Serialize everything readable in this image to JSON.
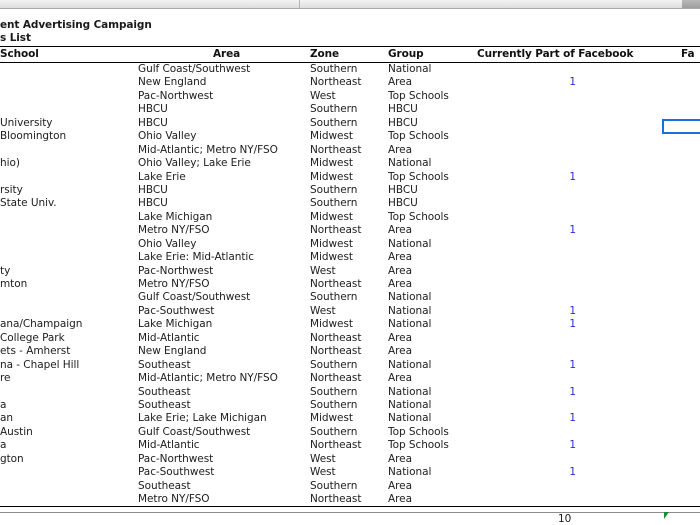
{
  "window": {
    "column_header_divider_x": [
      300,
      693,
      858,
      1065
    ],
    "scroll_corner": "scroll-corner"
  },
  "document": {
    "title": "ent Advertising Campaign",
    "subtitle": "s List"
  },
  "table": {
    "columns": [
      {
        "key": "school",
        "label": "School"
      },
      {
        "key": "area",
        "label": "Area"
      },
      {
        "key": "zone",
        "label": "Zone"
      },
      {
        "key": "group",
        "label": "Group"
      },
      {
        "key": "fb",
        "label": "Currently Part of Facebook"
      },
      {
        "key": "fb2",
        "label": "Fa"
      }
    ],
    "rows": [
      {
        "school": "",
        "area": "Gulf Coast/Southwest",
        "zone": "Southern",
        "group": "National",
        "fb": ""
      },
      {
        "school": "",
        "area": "New England",
        "zone": "Northeast",
        "group": "Area",
        "fb": "1"
      },
      {
        "school": "",
        "area": "Pac-Northwest",
        "zone": "West",
        "group": "Top Schools",
        "fb": ""
      },
      {
        "school": "",
        "area": "HBCU",
        "zone": "Southern",
        "group": "HBCU",
        "fb": ""
      },
      {
        "school": " University",
        "area": "HBCU",
        "zone": "Southern",
        "group": "HBCU",
        "fb": ""
      },
      {
        "school": " Bloomington",
        "area": "Ohio Valley",
        "zone": "Midwest",
        "group": "Top Schools",
        "fb": ""
      },
      {
        "school": "",
        "area": "Mid-Atlantic; Metro NY/FSO",
        "zone": "Northeast",
        "group": "Area",
        "fb": ""
      },
      {
        "school": "hio)",
        "area": "Ohio Valley; Lake Erie",
        "zone": "Midwest",
        "group": "National",
        "fb": ""
      },
      {
        "school": "",
        "area": "Lake Erie",
        "zone": "Midwest",
        "group": "Top Schools",
        "fb": "1"
      },
      {
        "school": "rsity",
        "area": "HBCU",
        "zone": "Southern",
        "group": "HBCU",
        "fb": ""
      },
      {
        "school": "State Univ.",
        "area": "HBCU",
        "zone": "Southern",
        "group": "HBCU",
        "fb": ""
      },
      {
        "school": "",
        "area": "Lake Michigan",
        "zone": "Midwest",
        "group": "Top Schools",
        "fb": ""
      },
      {
        "school": "",
        "area": "Metro NY/FSO",
        "zone": "Northeast",
        "group": "Area",
        "fb": "1"
      },
      {
        "school": "",
        "area": "Ohio Valley",
        "zone": "Midwest",
        "group": "National",
        "fb": ""
      },
      {
        "school": "",
        "area": "Lake Erie: Mid-Atlantic",
        "zone": "Midwest",
        "group": "Area",
        "fb": ""
      },
      {
        "school": "ty",
        "area": "Pac-Northwest",
        "zone": "West",
        "group": "Area",
        "fb": ""
      },
      {
        "school": "mton",
        "area": "Metro NY/FSO",
        "zone": "Northeast",
        "group": "Area",
        "fb": ""
      },
      {
        "school": "",
        "area": "Gulf Coast/Southwest",
        "zone": "Southern",
        "group": "National",
        "fb": ""
      },
      {
        "school": "",
        "area": "Pac-Southwest",
        "zone": "West",
        "group": "National",
        "fb": "1"
      },
      {
        "school": "ana/Champaign",
        "area": "Lake Michigan",
        "zone": "Midwest",
        "group": "National",
        "fb": "1"
      },
      {
        "school": "College Park",
        "area": "Mid-Atlantic",
        "zone": "Northeast",
        "group": "Area",
        "fb": ""
      },
      {
        "school": "ets - Amherst",
        "area": "New England",
        "zone": "Northeast",
        "group": "Area",
        "fb": ""
      },
      {
        "school": "na - Chapel Hill",
        "area": "Southeast",
        "zone": "Southern",
        "group": "National",
        "fb": "1"
      },
      {
        "school": "re",
        "area": "Mid-Atlantic; Metro NY/FSO",
        "zone": "Northeast",
        "group": "Area",
        "fb": ""
      },
      {
        "school": "",
        "area": "Southeast",
        "zone": "Southern",
        "group": "National",
        "fb": "1"
      },
      {
        "school": "a",
        "area": "Southeast",
        "zone": "Southern",
        "group": "National",
        "fb": ""
      },
      {
        "school": "an",
        "area": "Lake Erie; Lake Michigan",
        "zone": "Midwest",
        "group": "National",
        "fb": "1"
      },
      {
        "school": " Austin",
        "area": "Gulf Coast/Southwest",
        "zone": "Southern",
        "group": "Top Schools",
        "fb": ""
      },
      {
        "school": "a",
        "area": "Mid-Atlantic",
        "zone": "Northeast",
        "group": "Top Schools",
        "fb": "1"
      },
      {
        "school": "gton",
        "area": "Pac-Northwest",
        "zone": "West",
        "group": "Area",
        "fb": ""
      },
      {
        "school": "",
        "area": "Pac-Southwest",
        "zone": "West",
        "group": "National",
        "fb": "1"
      },
      {
        "school": "",
        "area": "Southeast",
        "zone": "Southern",
        "group": "Area",
        "fb": ""
      },
      {
        "school": "",
        "area": "Metro NY/FSO",
        "zone": "Northeast",
        "group": "Area",
        "fb": ""
      }
    ]
  },
  "selection": {
    "value": ""
  },
  "footer": {
    "page_number": "10",
    "marker": "green-triangle-marker"
  },
  "colors": {
    "link_blue": "#2b2bd0",
    "selection_blue": "#1a6fe0",
    "marker_green": "#1a8c3a",
    "text": "#1c1c1c"
  }
}
